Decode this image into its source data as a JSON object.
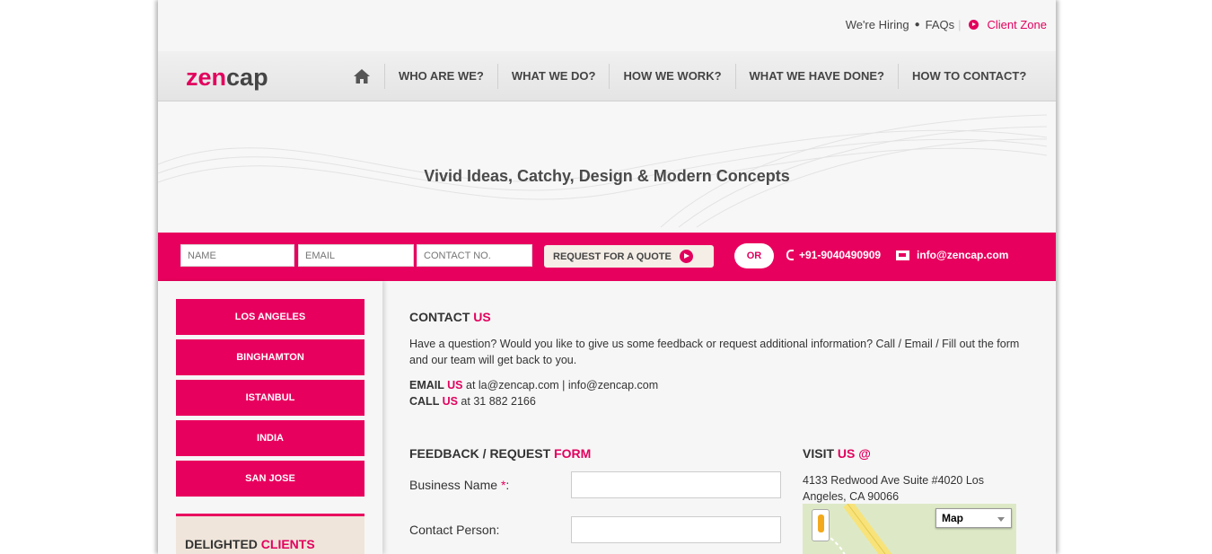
{
  "toplinks": {
    "hiring": "We're Hiring",
    "faqs": "FAQs",
    "client_zone": "Client Zone"
  },
  "logo": {
    "part1": "ze",
    "part2": "n",
    "part3": "cap"
  },
  "nav": {
    "items": [
      "WHO ARE WE?",
      "WHAT WE DO?",
      "HOW WE WORK?",
      "WHAT WE HAVE DONE?",
      "HOW TO CONTACT?"
    ]
  },
  "hero": {
    "tagline": "Vivid Ideas, Catchy, Design & Modern Concepts"
  },
  "quote": {
    "name_placeholder": "NAME",
    "email_placeholder": "EMAIL",
    "contact_placeholder": "CONTACT NO.",
    "button": "REQUEST FOR A QUOTE",
    "or": "OR",
    "phone": "+91-9040490909",
    "email": "info@zencap.com"
  },
  "sidebar": {
    "cities": [
      "LOS ANGELES",
      "BINGHAMTON",
      "ISTANBUL",
      "INDIA",
      "SAN JOSE"
    ],
    "clients_a": "DELIGHTED ",
    "clients_b": "CLIENTS"
  },
  "contact": {
    "title_a": "CONTACT ",
    "title_b": "US",
    "intro": "Have a question? Would you like to give us some feedback or request additional information? Call / Email / Fill out the form and our team will get back to you.",
    "email_label": "EMAIL ",
    "email_us": "US",
    "email_text": " at la@zencap.com | info@zencap.com",
    "call_label": "CALL ",
    "call_us": "US",
    "call_text": " at 31 882 2166"
  },
  "form": {
    "title_a": "FEEDBACK / REQUEST ",
    "title_b": "FORM",
    "business_label": "Business Name ",
    "required": "*",
    "colon": ":",
    "contact_label": "Contact Person:"
  },
  "visit": {
    "title_a": "VISIT ",
    "title_b": "US @",
    "address": "4133 Redwood Ave Suite #4020 Los Angeles, CA 90066",
    "map_type": "Map"
  },
  "colors": {
    "accent": "#e8005e",
    "text": "#333333"
  }
}
